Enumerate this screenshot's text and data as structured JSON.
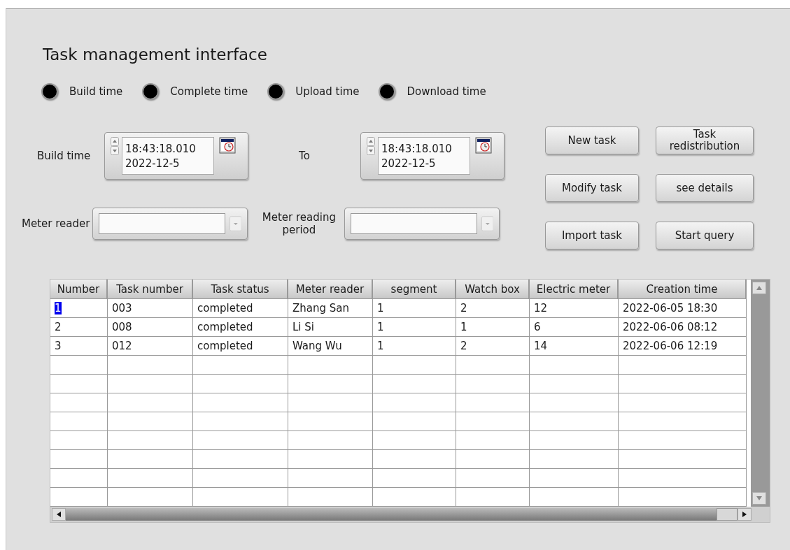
{
  "title": "Task management interface",
  "time_options": [
    {
      "label": "Build time",
      "on": false
    },
    {
      "label": "Complete time",
      "on": false
    },
    {
      "label": "Upload time",
      "on": false
    },
    {
      "label": "Download time",
      "on": false
    }
  ],
  "filters": {
    "from_label": "Build time",
    "from": {
      "time": "18:43:18.010",
      "date": "2022-12-5"
    },
    "to_label": "To",
    "to": {
      "time": "18:43:18.010",
      "date": "2022-12-5"
    },
    "meter_reader_label": "Meter reader",
    "period_label": "Meter reading period"
  },
  "buttons": [
    "New task",
    "Task redistribution",
    "Modify task",
    "see details",
    "Import task",
    "Start query"
  ],
  "table": {
    "columns": [
      "Number",
      "Task number",
      "Task status",
      "Meter reader",
      "segment",
      "Watch box",
      "Electric meter",
      "Creation time"
    ],
    "rows": [
      {
        "selected": true,
        "cells": [
          "1",
          "003",
          "completed",
          "Zhang San",
          "1",
          "2",
          "12",
          "2022-06-05 18:30"
        ]
      },
      {
        "selected": false,
        "cells": [
          "2",
          "008",
          "completed",
          "Li Si",
          "1",
          "1",
          "6",
          "2022-06-06 08:12"
        ]
      },
      {
        "selected": false,
        "cells": [
          "3",
          "012",
          "completed",
          "Wang Wu",
          "1",
          "2",
          "14",
          "2022-06-06 12:19"
        ]
      }
    ]
  }
}
